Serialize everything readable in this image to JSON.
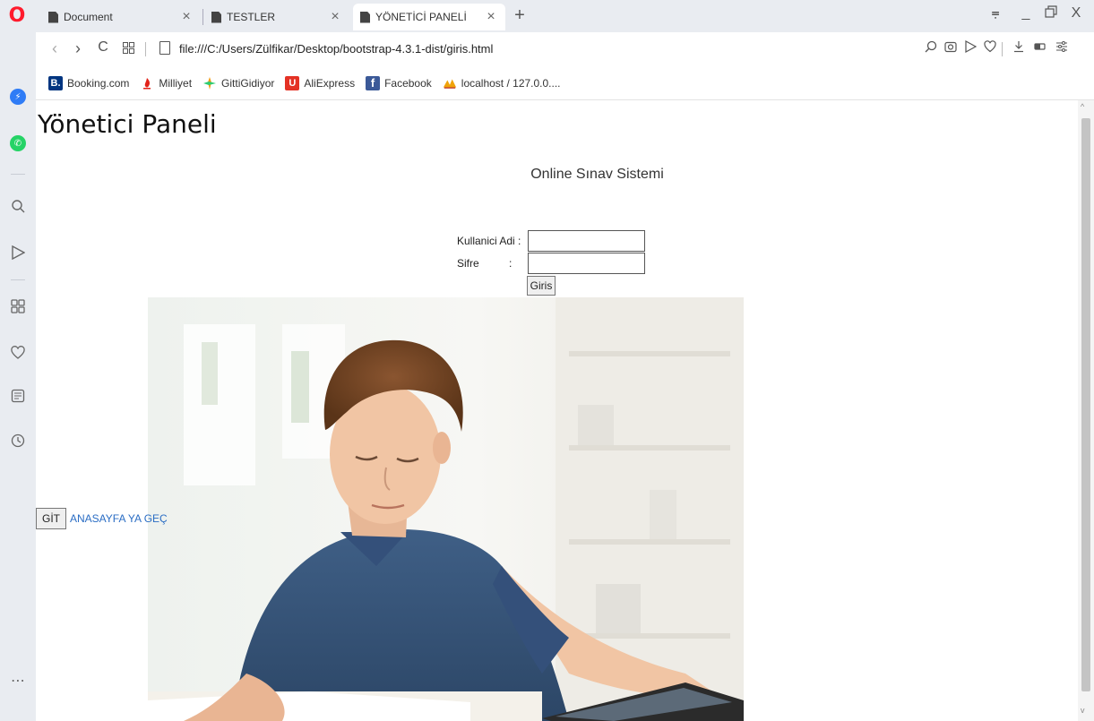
{
  "tabs": [
    {
      "title": "Document",
      "active": false
    },
    {
      "title": "TESTLER",
      "active": false
    },
    {
      "title": "YÖNETİCİ PANELİ",
      "active": true
    }
  ],
  "tab_close_glyph": "×",
  "new_tab_glyph": "+",
  "window_controls": {
    "menu": "⩦",
    "minimize": "_",
    "restore": "🗗",
    "close": "X"
  },
  "address": {
    "url": "file:///C:/Users/Zülfikar/Desktop/bootstrap-4.3.1-dist/giris.html"
  },
  "bookmarks": [
    {
      "label": "Booking.com",
      "icon": "booking-icon",
      "color": "#003580",
      "glyph": "B."
    },
    {
      "label": "Milliyet",
      "icon": "milliyet-icon",
      "color": "#e2231a",
      "glyph": ""
    },
    {
      "label": "GittiGidiyor",
      "icon": "gittigidiyor-icon",
      "color": "#f39c12",
      "glyph": ""
    },
    {
      "label": "AliExpress",
      "icon": "aliexpress-icon",
      "color": "#e43225",
      "glyph": "U"
    },
    {
      "label": "Facebook",
      "icon": "facebook-icon",
      "color": "#3b5998",
      "glyph": "f"
    },
    {
      "label": "localhost / 127.0.0....",
      "icon": "phpmyadmin-icon",
      "color": "#f0a30a",
      "glyph": ""
    }
  ],
  "page": {
    "title": "Yönetici Paneli",
    "subtitle": "Online Sınav Sistemi",
    "form": {
      "username_label": "Kullanici Adi :",
      "password_label": "Sifre          :",
      "username_value": "",
      "password_value": "",
      "submit_label": "Giris"
    },
    "go_button": "GİT",
    "home_link": "ANASAYFA YA GEÇ"
  },
  "colors": {
    "accent": "#ff1b2d",
    "link": "#2a6dc4",
    "chrome": "#e9ecf1"
  }
}
